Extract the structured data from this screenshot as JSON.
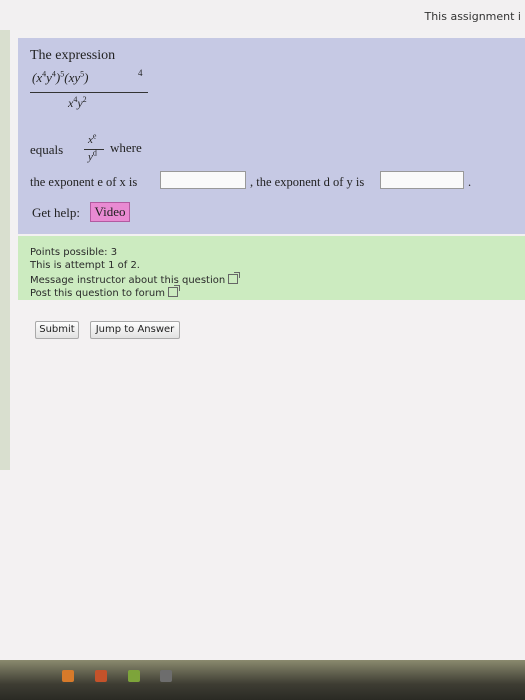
{
  "top_notice": "This assignment i",
  "question": {
    "intro": "The expression",
    "fraction": {
      "numerator": {
        "base1": "x",
        "exp1": "4",
        "base2": "y",
        "exp2": "4",
        "outer_exp1": "5",
        "base3": "x",
        "base4": "y",
        "exp4": "5",
        "outer_exp2": "4"
      },
      "denominator": {
        "base1": "x",
        "exp1": "4",
        "base2": "y",
        "exp2": "2"
      }
    },
    "equals_label": "equals",
    "result_fraction": {
      "num_base": "x",
      "num_exp": "e",
      "den_base": "y",
      "den_exp": "d"
    },
    "where_label": "where",
    "exponent_e_label": "the exponent e of x is",
    "exponent_e_value": "",
    "exponent_d_label": ", the exponent d of y is",
    "exponent_d_value": "",
    "trailing_period": ".",
    "get_help_label": "Get help:",
    "video_label": "Video"
  },
  "info": {
    "points": "Points possible: 3",
    "attempt": "This is attempt 1 of 2.",
    "message_link": "Message instructor about this question",
    "forum_link": "Post this question to forum"
  },
  "actions": {
    "submit": "Submit",
    "jump": "Jump to Answer"
  },
  "colors": {
    "question_bg": "#c6c9e4",
    "info_bg": "#ccebc0",
    "video_bg": "#e98ad2"
  }
}
